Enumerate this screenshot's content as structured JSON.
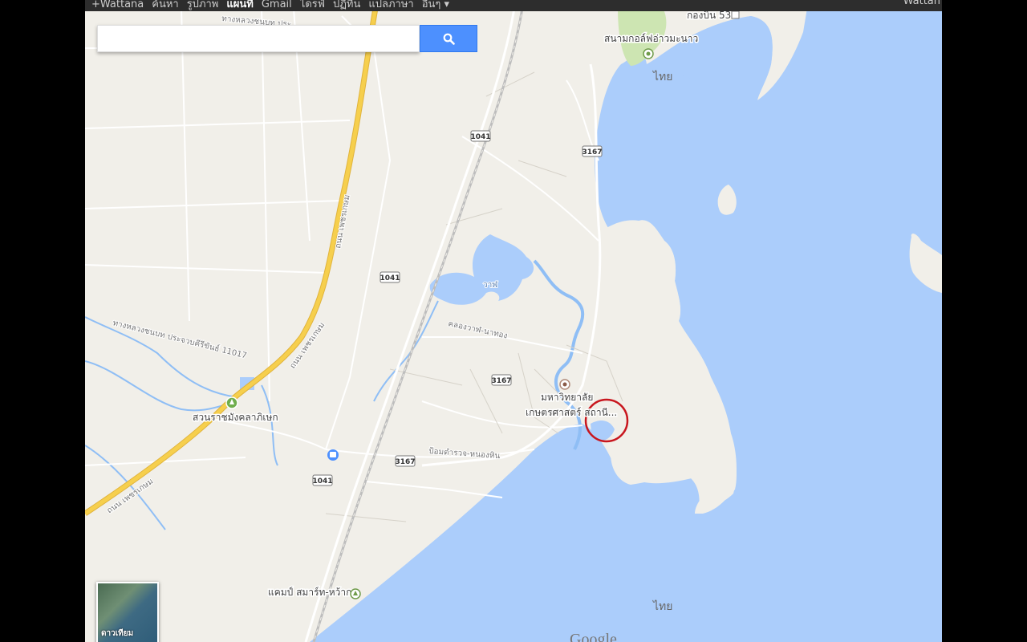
{
  "topbar": {
    "nav_items": [
      "+Wattana",
      "ค้นหา",
      "รูปภาพ",
      "แผนที่",
      "Gmail",
      "ไดรฟ์",
      "ปฏิทิน",
      "แปลภาษา",
      "อื่นๆ ▾"
    ],
    "active_item": "แผนที่",
    "user": "Wattan"
  },
  "search": {
    "value": "",
    "placeholder": ""
  },
  "map_labels": {
    "golf": "สนามกอล์ฟอ่าวมะนาว",
    "wing": "กองบิน 53",
    "thai_north": "ไทย",
    "thai_south": "ไทย",
    "lake": "วาฬ",
    "canal": "คลองวาฬ-นาทอง",
    "university_1": "มหาวิทยาลัย",
    "university_2": "เกษตรศาสตร์ สถานี...",
    "garden": "สวนราชมังคลาภิเษก",
    "road_phet_1": "ถนน เพชรเกษม",
    "road_phet_2": "ถนน เพชรเกษม",
    "road_phet_3": "ถนน เพชรเกษม",
    "highway_label": "ทางหลวงชนบท ประจวบคีรีขันธ์ 11017",
    "highway_top": "ทางหลวงชนบท ประ...",
    "checkpoint": "ป้อมตำรวจ-หนองหิน",
    "camp": "แคมป์ สมาร์ท-หว้ากอ"
  },
  "route_shields": [
    "1041",
    "3167",
    "1041",
    "3167",
    "3167",
    "1041"
  ],
  "satellite_label": "ดาวเทียม",
  "attribution": "Google",
  "colors": {
    "water": "#abcdfb",
    "land": "#f1efe9",
    "park": "#cde5b2",
    "highway": "#f6cf4d",
    "river": "#8fbef5",
    "highlight": "#c8161e",
    "search_button": "#4d90fe"
  }
}
